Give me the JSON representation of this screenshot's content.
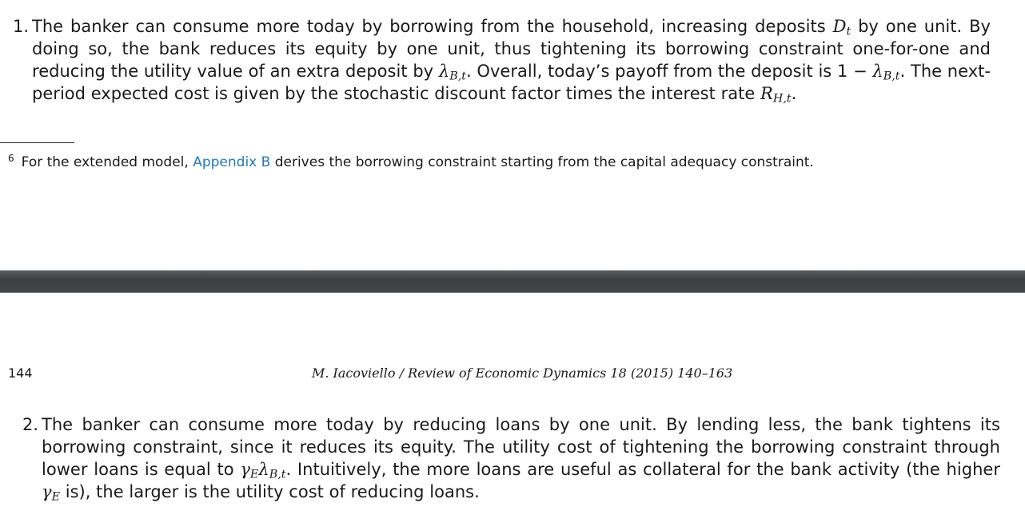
{
  "page_upper": {
    "item1": {
      "number": "1.",
      "t1": "The banker can consume more today by borrowing from the household, increasing deposits ",
      "m1": "D",
      "m1_sub": "t",
      "t2": " by one unit. By doing so, the bank reduces its equity by one unit, thus tightening its borrowing constraint one-for-one and reducing the utility value of an extra deposit by ",
      "m2": "λ",
      "m2_sub": "B,t",
      "t3": ". Overall, today’s payoff from the deposit is 1 − ",
      "m3": "λ",
      "m3_sub": "B,t",
      "t4": ". The next-period expected cost is given by the stochastic discount factor times the interest rate ",
      "m4": "R",
      "m4_sub": "H,t",
      "t5": "."
    },
    "footnote": {
      "mark": "6",
      "text_before": "For the extended model, ",
      "link": "Appendix B",
      "text_after": " derives the borrowing constraint starting from the capital adequacy constraint."
    }
  },
  "page_lower": {
    "page_number": "144",
    "running_head": "M. Iacoviello / Review of Economic Dynamics 18 (2015) 140–163",
    "item2": {
      "number": "2.",
      "t1": "The banker can consume more today by reducing loans by one unit. By lending less, the bank tightens its borrowing constraint, since it reduces its equity. The utility cost of tightening the borrowing constraint through lower loans is equal to ",
      "m1": "γ",
      "m1_sub": "E",
      "m2": "λ",
      "m2_sub": "B,t",
      "t2": ". Intuitively, the more loans are useful as collateral for the bank activity (the higher ",
      "m3": "γ",
      "m3_sub": "E",
      "t3": " is), the larger is the utility cost of reducing loans."
    }
  },
  "colors": {
    "link": "#2a79b4",
    "page_gap": "#444749",
    "text": "#1a1a1a"
  }
}
